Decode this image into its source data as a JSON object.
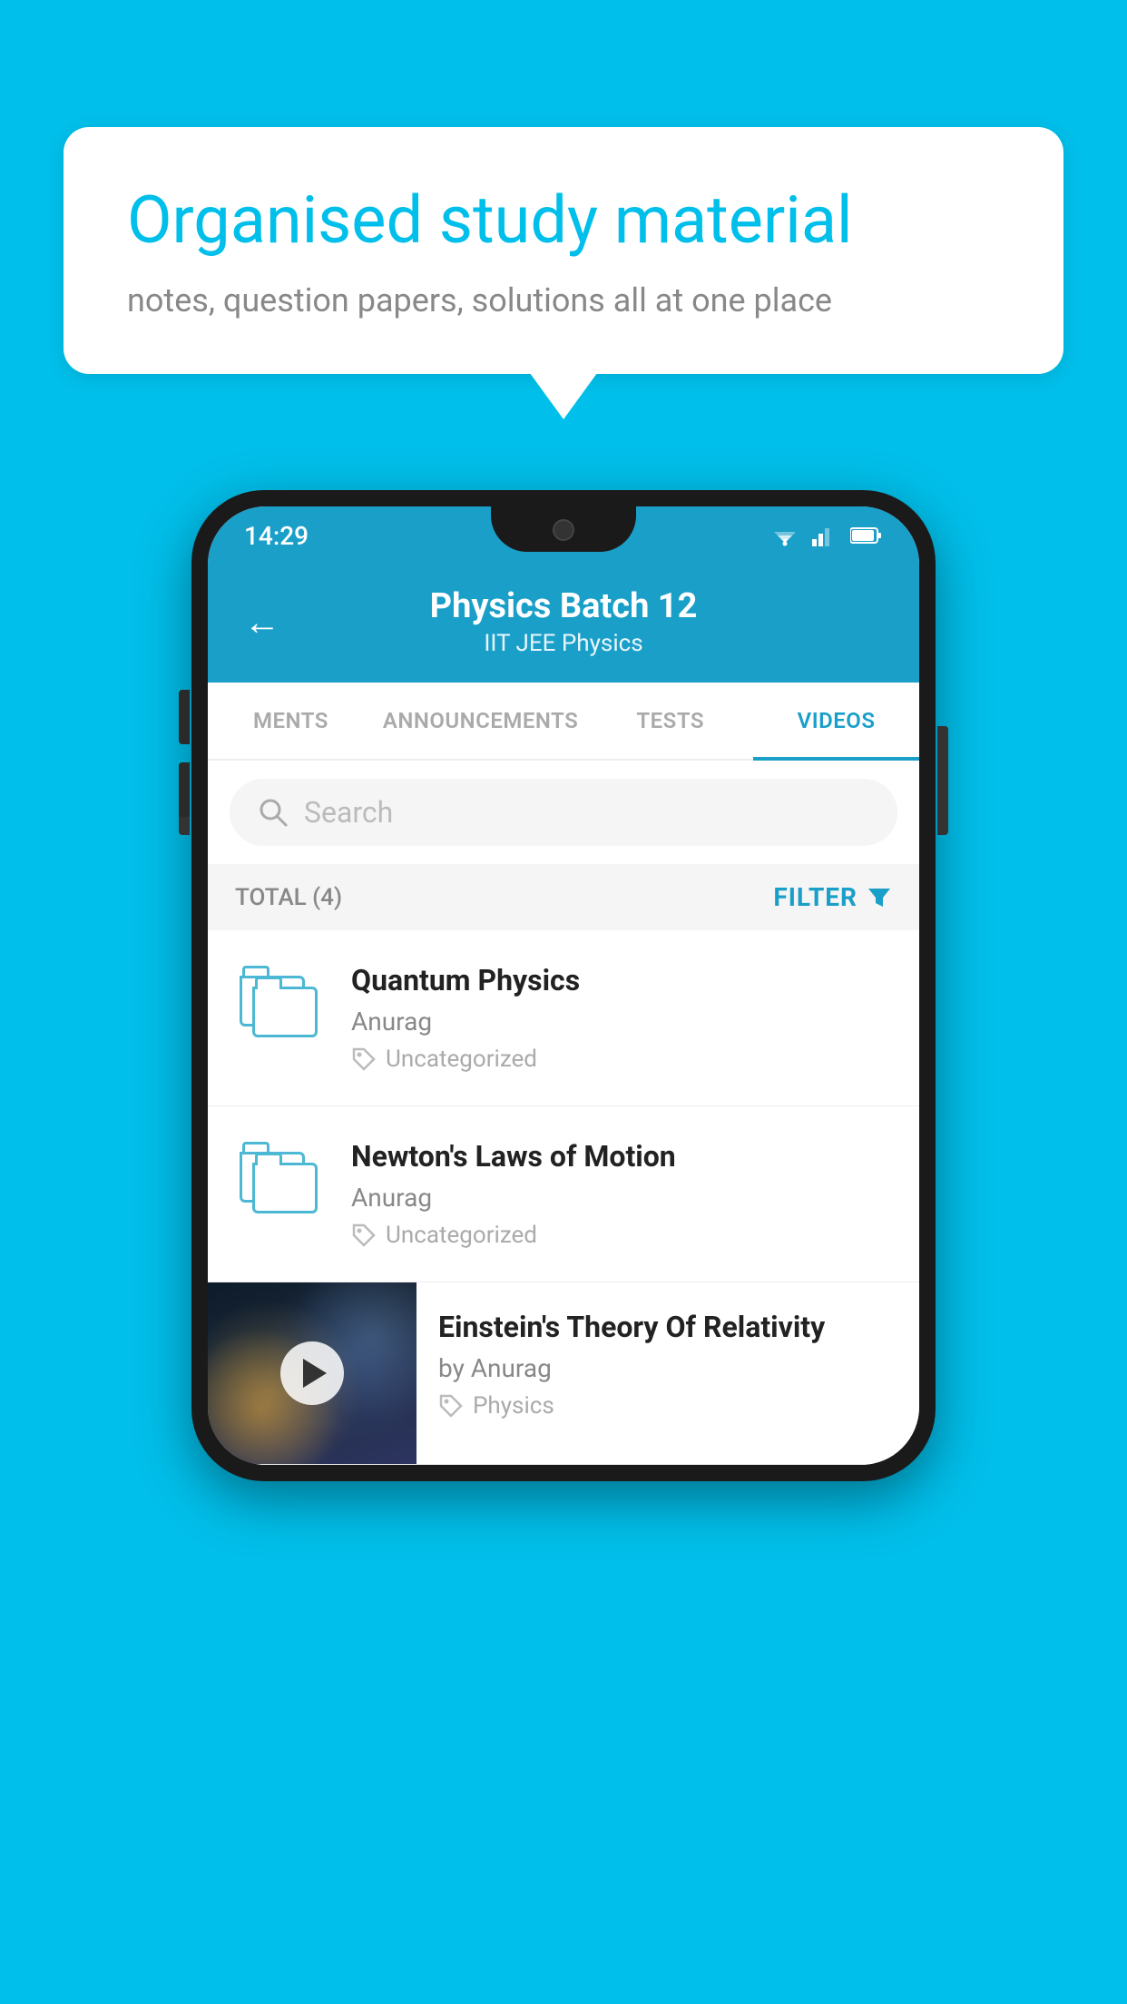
{
  "background": {
    "color": "#00BFEA"
  },
  "speech_bubble": {
    "title": "Organised study material",
    "subtitle": "notes, question papers, solutions all at one place"
  },
  "phone": {
    "status_bar": {
      "time": "14:29"
    },
    "header": {
      "back_label": "←",
      "title": "Physics Batch 12",
      "subtitle": "IIT JEE   Physics"
    },
    "tabs": [
      {
        "label": "MENTS",
        "active": false
      },
      {
        "label": "ANNOUNCEMENTS",
        "active": false
      },
      {
        "label": "TESTS",
        "active": false
      },
      {
        "label": "VIDEOS",
        "active": true
      }
    ],
    "search": {
      "placeholder": "Search"
    },
    "filter": {
      "total_label": "TOTAL (4)",
      "filter_label": "FILTER"
    },
    "videos": [
      {
        "id": 1,
        "title": "Quantum Physics",
        "author": "Anurag",
        "tag": "Uncategorized",
        "has_thumbnail": false
      },
      {
        "id": 2,
        "title": "Newton's Laws of Motion",
        "author": "Anurag",
        "tag": "Uncategorized",
        "has_thumbnail": false
      },
      {
        "id": 3,
        "title": "Einstein's Theory Of Relativity",
        "author": "by Anurag",
        "tag": "Physics",
        "has_thumbnail": true
      }
    ]
  }
}
